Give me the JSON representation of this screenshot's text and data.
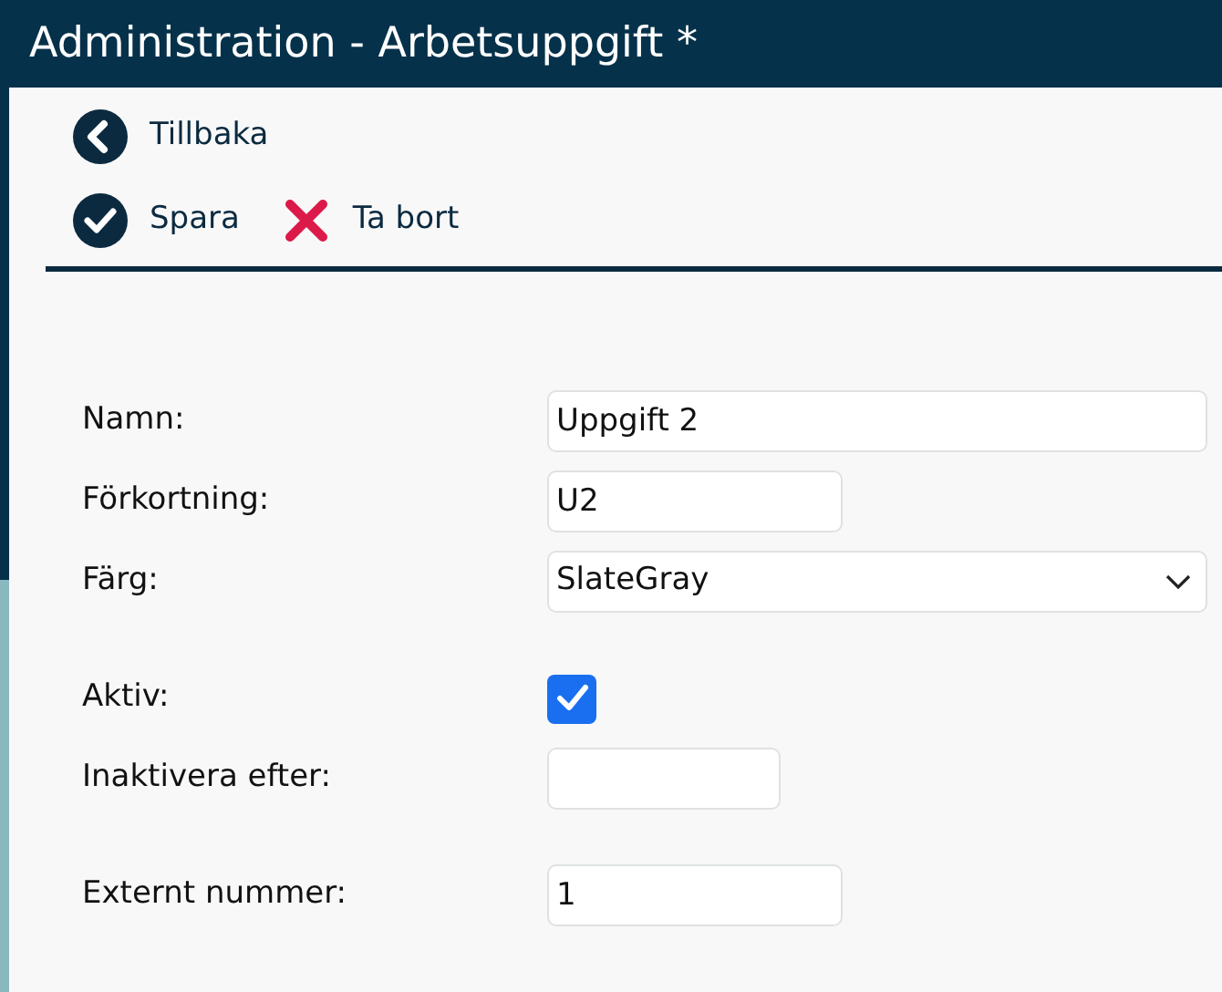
{
  "window": {
    "title": "Administration - Arbetsuppgift *"
  },
  "back": {
    "label": "Tillbaka"
  },
  "toolbar": [
    {
      "kind": "save",
      "label": "Spara"
    },
    {
      "kind": "delete",
      "label": "Ta bort"
    }
  ],
  "sections": [
    {
      "fields": [
        {
          "kind": "text",
          "label": "Namn:",
          "value": "Uppgift 2"
        },
        {
          "kind": "code",
          "label": "Förkortning:",
          "value": "U2"
        },
        {
          "kind": "select",
          "label": "Färg:",
          "value": "SlateGray"
        }
      ]
    },
    {
      "fields": [
        {
          "kind": "checkbox",
          "label": "Aktiv:",
          "checked": true
        },
        {
          "kind": "date",
          "label": "Inaktivera efter:"
        }
      ]
    },
    {
      "fields": [
        {
          "kind": "code",
          "label": "Externt nummer:",
          "value": "1"
        }
      ]
    }
  ]
}
